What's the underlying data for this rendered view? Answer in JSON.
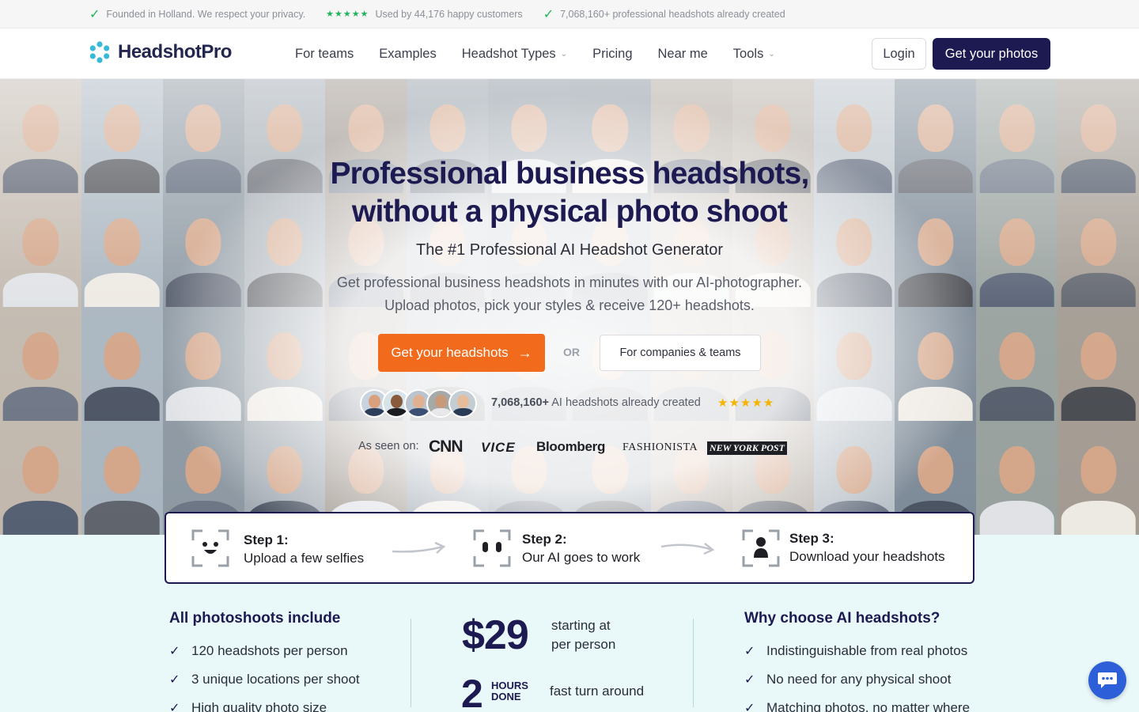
{
  "topbar": {
    "items": [
      {
        "icon": "check-icon",
        "text": "Founded in Holland. We respect your privacy."
      },
      {
        "icon": "stars-icon",
        "text": "Used by 44,176 happy customers"
      },
      {
        "icon": "check-icon",
        "text": "7,068,160+ professional headshots already created"
      }
    ],
    "star_glyphs": "★★★★★"
  },
  "header": {
    "logo_text": "HeadshotPro",
    "nav": [
      "For teams",
      "Examples",
      "Headshot Types",
      "Pricing",
      "Near me",
      "Tools"
    ],
    "chevron": "⌄",
    "login_label": "Login",
    "cta_label": "Get your photos"
  },
  "hero": {
    "title_line1": "Professional business headshots,",
    "title_line2": "without a physical photo shoot",
    "subtitle": "The #1 Professional AI Headshot Generator",
    "lead_line1": "Get professional business headshots in minutes with our AI-photographer.",
    "lead_line2": "Upload photos, pick your styles & receive 120+ headshots.",
    "cta_primary": "Get your headshots",
    "cta_arrow": "→",
    "or_label": "OR",
    "cta_secondary": "For companies & teams",
    "proof_count": "7,068,160+",
    "proof_text": " AI headshots already created",
    "proof_stars": "★★★★★",
    "seen_on_label": "As seen on:",
    "press": [
      "CNN",
      "VICE",
      "Bloomberg",
      "FASHIONISTA",
      "NEW YORK POST"
    ]
  },
  "steps": [
    {
      "title": "Step 1:",
      "desc": "Upload a few selfies"
    },
    {
      "title": "Step 2:",
      "desc": "Our AI goes to work"
    },
    {
      "title": "Step 3:",
      "desc": "Download your headshots"
    }
  ],
  "includes": {
    "heading": "All photoshoots include",
    "items": [
      "120 headshots per person",
      "3 unique locations per shoot",
      "High quality photo size"
    ]
  },
  "pricing": {
    "price": "$29",
    "price_note_line1": "starting at",
    "price_note_line2": "per person",
    "hours_number": "2",
    "hours_label_line1": "HOURS",
    "hours_label_line2": "DONE",
    "hours_note": "fast turn around"
  },
  "why": {
    "heading": "Why choose AI headshots?",
    "items": [
      "Indistinguishable from real photos",
      "No need for any physical shoot",
      "Matching photos, no matter where"
    ]
  },
  "colors": {
    "brand_navy": "#1d1a52",
    "cta_orange": "#f26b1d",
    "check_green": "#22b35e",
    "star_gold": "#f5b400",
    "section_mint": "#e9f8f9",
    "chat_blue": "#2d5fd8"
  },
  "check_glyph": "✓"
}
